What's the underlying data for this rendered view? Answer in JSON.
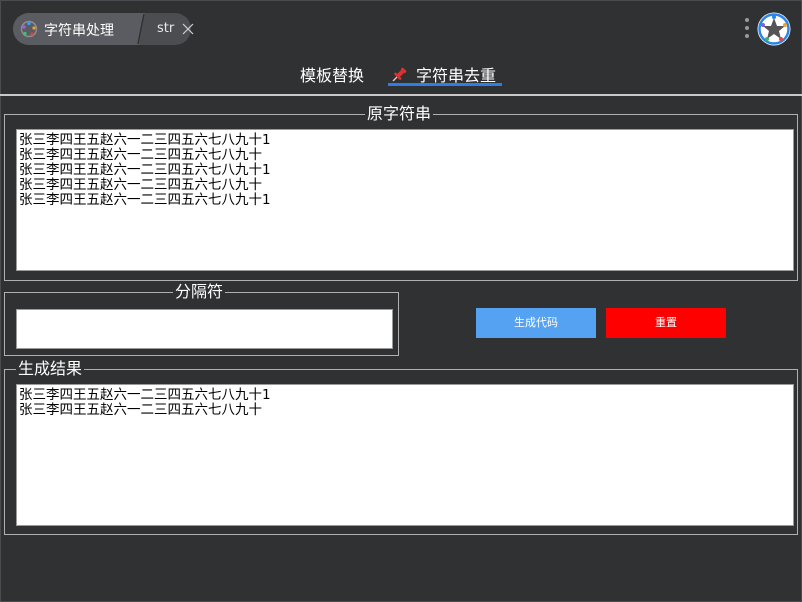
{
  "header": {
    "app_title": "字符串处理",
    "sub_label": "str"
  },
  "tabs": [
    {
      "label": "模板替换"
    },
    {
      "label": "字符串去重",
      "active": true
    }
  ],
  "source": {
    "legend": "原字符串",
    "text": "张三李四王五赵六一二三四五六七八九十1\n张三李四王五赵六一二三四五六七八九十\n张三李四王五赵六一二三四五六七八九十1\n张三李四王五赵六一二三四五六七八九十\n张三李四王五赵六一二三四五六七八九十1"
  },
  "separator": {
    "legend": "分隔符",
    "value": ""
  },
  "actions": {
    "generate_label": "生成代码",
    "reset_label": "重置"
  },
  "result": {
    "legend": "生成结果",
    "text": "张三李四王五赵六一二三四五六七八九十1\n张三李四王五赵六一二三四五六七八九十"
  },
  "colors": {
    "background": "#303133",
    "accent": "#2f7de1",
    "generate_button": "#55a2f3",
    "reset_button": "#ff0000"
  },
  "icons": [
    "app-logo-icon",
    "close-icon",
    "more-vertical-icon",
    "app-badge-icon",
    "pin-icon"
  ]
}
